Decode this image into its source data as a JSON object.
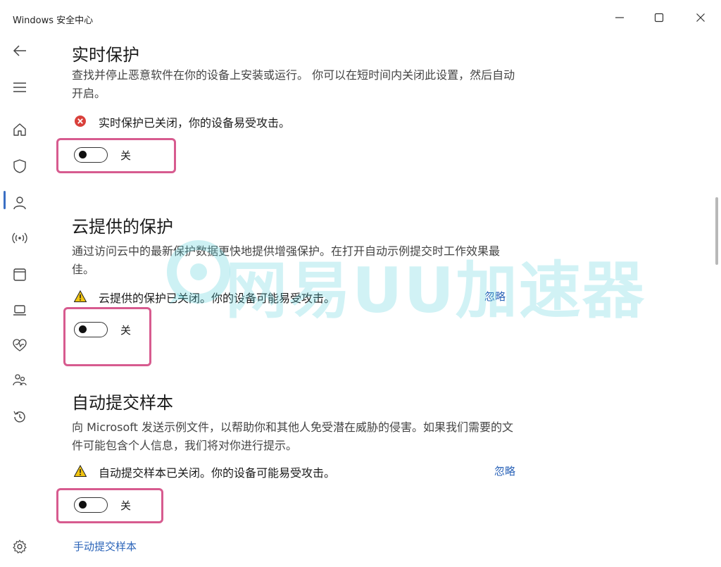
{
  "window": {
    "title": "Windows 安全中心"
  },
  "nav": {
    "items": [
      {
        "name": "back",
        "icon": "back-arrow-icon"
      },
      {
        "name": "menu",
        "icon": "hamburger-icon"
      },
      {
        "name": "home",
        "icon": "home-icon"
      },
      {
        "name": "virus-protection",
        "icon": "shield-icon"
      },
      {
        "name": "account-protection",
        "icon": "person-icon"
      },
      {
        "name": "firewall",
        "icon": "wifi-signal-icon"
      },
      {
        "name": "app-browser-control",
        "icon": "browser-window-icon"
      },
      {
        "name": "device-security",
        "icon": "laptop-icon"
      },
      {
        "name": "device-performance",
        "icon": "heart-pulse-icon"
      },
      {
        "name": "family-options",
        "icon": "family-icon"
      },
      {
        "name": "protection-history",
        "icon": "history-icon"
      },
      {
        "name": "settings",
        "icon": "gear-icon"
      }
    ],
    "active": "virus-protection"
  },
  "sections": [
    {
      "title": "实时保护",
      "description": "查找并停止恶意软件在你的设备上安装或运行。 你可以在短时间内关闭此设置，然后自动开启。",
      "status": {
        "type": "error",
        "text": "实时保护已关闭，你的设备易受攻击。"
      },
      "toggle": {
        "state": "off",
        "label": "关"
      }
    },
    {
      "title": "云提供的保护",
      "description": "通过访问云中的最新保护数据更快地提供增强保护。在打开自动示例提交时工作效果最佳。",
      "status": {
        "type": "warning",
        "text": "云提供的保护已关闭。你的设备可能易受攻击。"
      },
      "dismiss": "忽略",
      "toggle": {
        "state": "off",
        "label": "关"
      }
    },
    {
      "title": "自动提交样本",
      "description": "向 Microsoft 发送示例文件，以帮助你和其他人免受潜在威胁的侵害。如果我们需要的文件可能包含个人信息，我们将对你进行提示。",
      "status": {
        "type": "warning",
        "text": "自动提交样本已关闭。你的设备可能易受攻击。"
      },
      "dismiss": "忽略",
      "toggle": {
        "state": "off",
        "label": "关"
      }
    }
  ],
  "manual_submit_link": "手动提交样本",
  "watermark": {
    "text": "网易UU加速器"
  },
  "colors": {
    "accent": "#2a63b8",
    "highlight_border": "#d75b8f",
    "error": "#d9403b",
    "warning": "#f1c40f"
  }
}
